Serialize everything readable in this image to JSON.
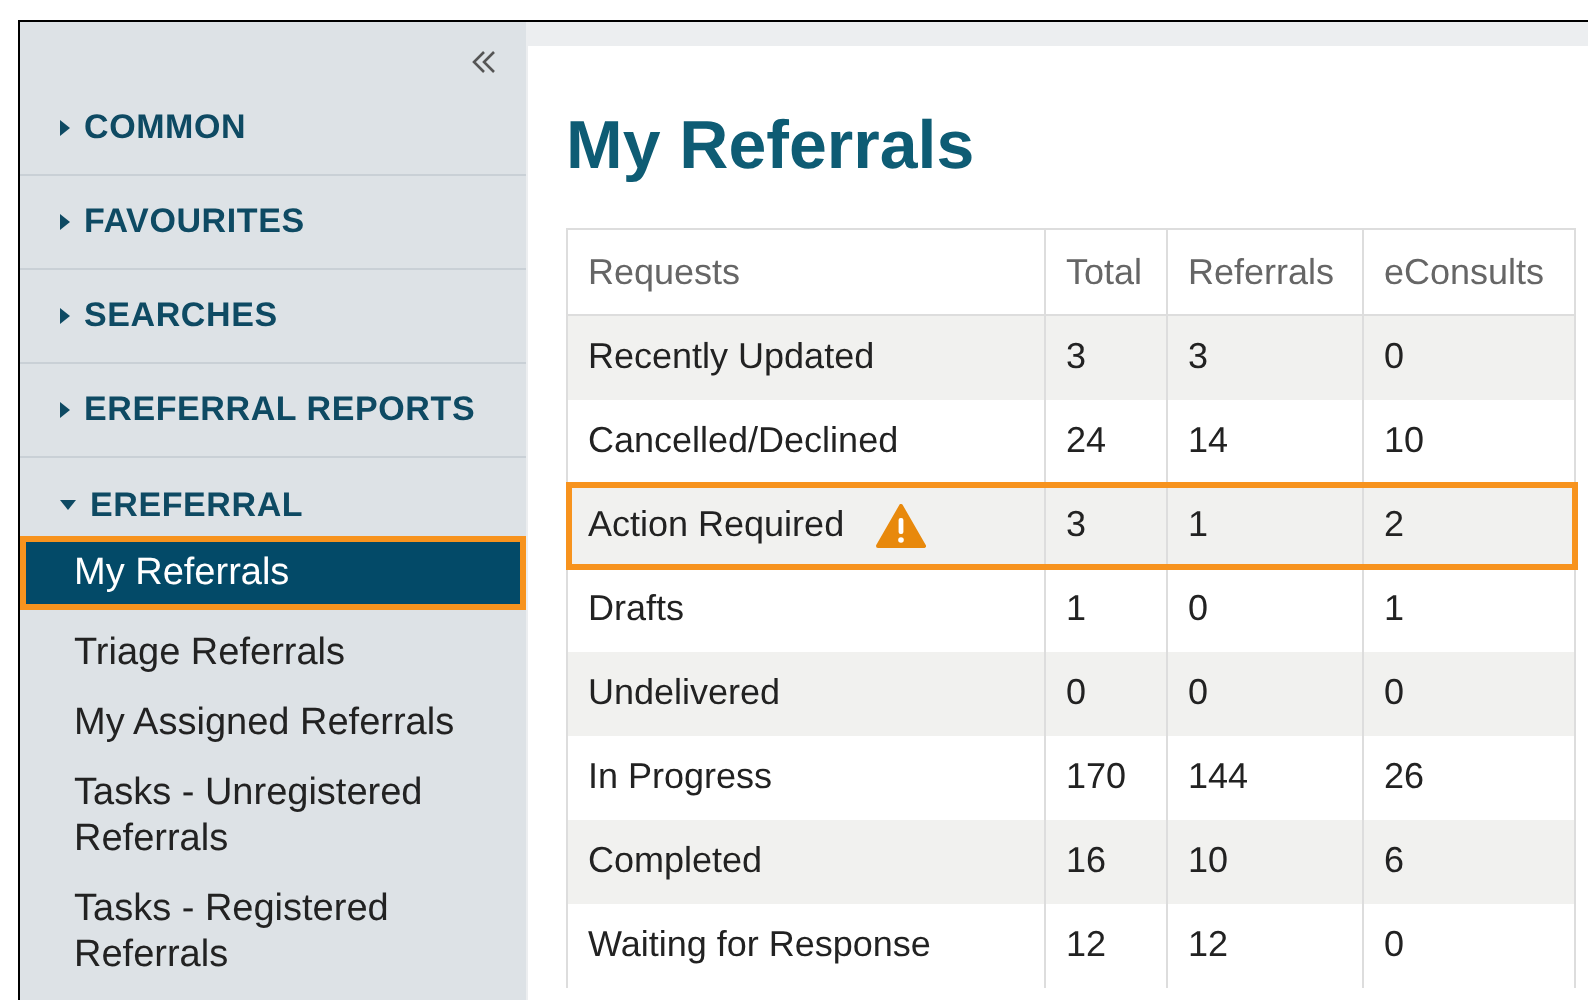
{
  "sidebar": {
    "sections": [
      {
        "label": "COMMON",
        "expanded": false
      },
      {
        "label": "FAVOURITES",
        "expanded": false
      },
      {
        "label": "SEARCHES",
        "expanded": false
      },
      {
        "label": "EREFERRAL REPORTS",
        "expanded": false
      },
      {
        "label": "EREFERRAL",
        "expanded": true,
        "items": [
          {
            "label": "My Referrals",
            "selected": true
          },
          {
            "label": "Triage Referrals",
            "selected": false
          },
          {
            "label": "My Assigned Referrals",
            "selected": false
          },
          {
            "label": "Tasks - Unregistered Referrals",
            "selected": false
          },
          {
            "label": "Tasks - Registered Referrals",
            "selected": false
          }
        ]
      }
    ]
  },
  "page": {
    "title": "My Referrals"
  },
  "table": {
    "columns": [
      "Requests",
      "Total",
      "Referrals",
      "eConsults"
    ],
    "rows": [
      {
        "cells": [
          "Recently Updated",
          "3",
          "3",
          "0"
        ],
        "highlighted": false,
        "warning": false
      },
      {
        "cells": [
          "Cancelled/Declined",
          "24",
          "14",
          "10"
        ],
        "highlighted": false,
        "warning": false
      },
      {
        "cells": [
          "Action Required",
          "3",
          "1",
          "2"
        ],
        "highlighted": true,
        "warning": true
      },
      {
        "cells": [
          "Drafts",
          "1",
          "0",
          "1"
        ],
        "highlighted": false,
        "warning": false
      },
      {
        "cells": [
          "Undelivered",
          "0",
          "0",
          "0"
        ],
        "highlighted": false,
        "warning": false
      },
      {
        "cells": [
          "In Progress",
          "170",
          "144",
          "26"
        ],
        "highlighted": false,
        "warning": false
      },
      {
        "cells": [
          "Completed",
          "16",
          "10",
          "6"
        ],
        "highlighted": false,
        "warning": false
      },
      {
        "cells": [
          "Waiting for Response",
          "12",
          "12",
          "0"
        ],
        "highlighted": false,
        "warning": false
      }
    ]
  }
}
